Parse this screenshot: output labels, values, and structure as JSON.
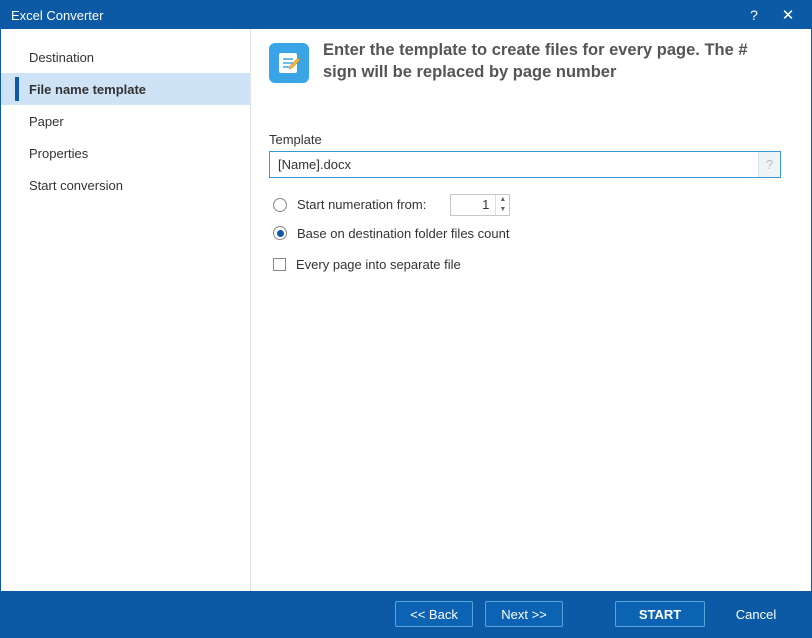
{
  "window": {
    "title": "Excel Converter"
  },
  "sidebar": {
    "items": [
      {
        "label": "Destination"
      },
      {
        "label": "File name template"
      },
      {
        "label": "Paper"
      },
      {
        "label": "Properties"
      },
      {
        "label": "Start conversion"
      }
    ]
  },
  "main": {
    "heading": "Enter the template to create files for every page. The # sign will be replaced by page number",
    "template_label": "Template",
    "template_value": "[Name].docx",
    "hint_symbol": "?",
    "radio_start_numeration": "Start numeration from:",
    "numeration_value": "1",
    "radio_base_folder": "Base on destination folder files count",
    "checkbox_separate": "Every page into separate file"
  },
  "footer": {
    "back": "<<  Back",
    "next": "Next  >>",
    "start": "START",
    "cancel": "Cancel"
  }
}
